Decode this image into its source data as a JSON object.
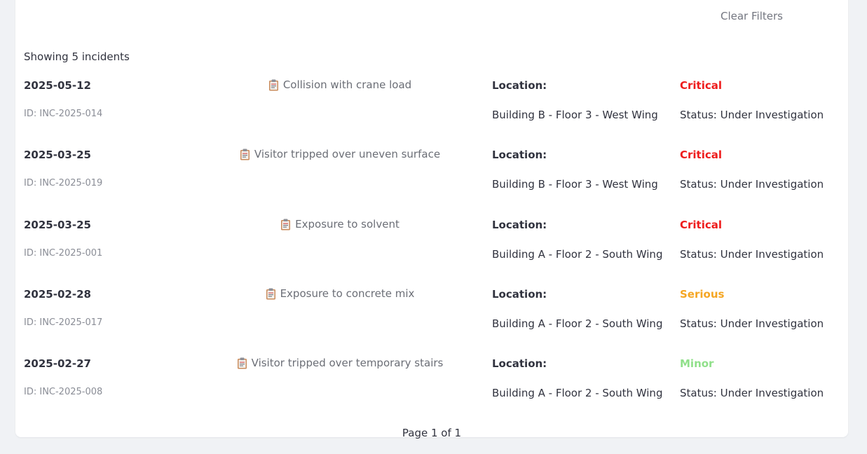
{
  "filters": {
    "clear_label": "Clear Filters"
  },
  "summary": {
    "showing_text": "Showing 5 incidents"
  },
  "colors": {
    "critical": "#ee1c1c",
    "serious": "#f5a623",
    "minor": "#90e08a"
  },
  "incidents": [
    {
      "date": "2025-05-12",
      "id": "ID: INC-2025-014",
      "icon": "clipboard-icon",
      "title": "Collision with crane load",
      "location_label": "Location:",
      "location": "Building B - Floor 3 - West Wing",
      "severity": "Critical",
      "severity_color": "#ee1c1c",
      "status": "Status: Under Investigation"
    },
    {
      "date": "2025-03-25",
      "id": "ID: INC-2025-019",
      "icon": "clipboard-icon",
      "title": "Visitor tripped over uneven surface",
      "location_label": "Location:",
      "location": "Building B - Floor 3 - West Wing",
      "severity": "Critical",
      "severity_color": "#ee1c1c",
      "status": "Status: Under Investigation"
    },
    {
      "date": "2025-03-25",
      "id": "ID: INC-2025-001",
      "icon": "clipboard-icon",
      "title": "Exposure to solvent",
      "location_label": "Location:",
      "location": "Building A - Floor 2 - South Wing",
      "severity": "Critical",
      "severity_color": "#ee1c1c",
      "status": "Status: Under Investigation"
    },
    {
      "date": "2025-02-28",
      "id": "ID: INC-2025-017",
      "icon": "clipboard-icon",
      "title": "Exposure to concrete mix",
      "location_label": "Location:",
      "location": "Building A - Floor 2 - South Wing",
      "severity": "Serious",
      "severity_color": "#f5a623",
      "status": "Status: Under Investigation"
    },
    {
      "date": "2025-02-27",
      "id": "ID: INC-2025-008",
      "icon": "clipboard-icon",
      "title": "Visitor tripped over temporary stairs",
      "location_label": "Location:",
      "location": "Building A - Floor 2 - South Wing",
      "severity": "Minor",
      "severity_color": "#90e08a",
      "status": "Status: Under Investigation"
    }
  ],
  "pagination": {
    "text": "Page 1 of 1"
  }
}
